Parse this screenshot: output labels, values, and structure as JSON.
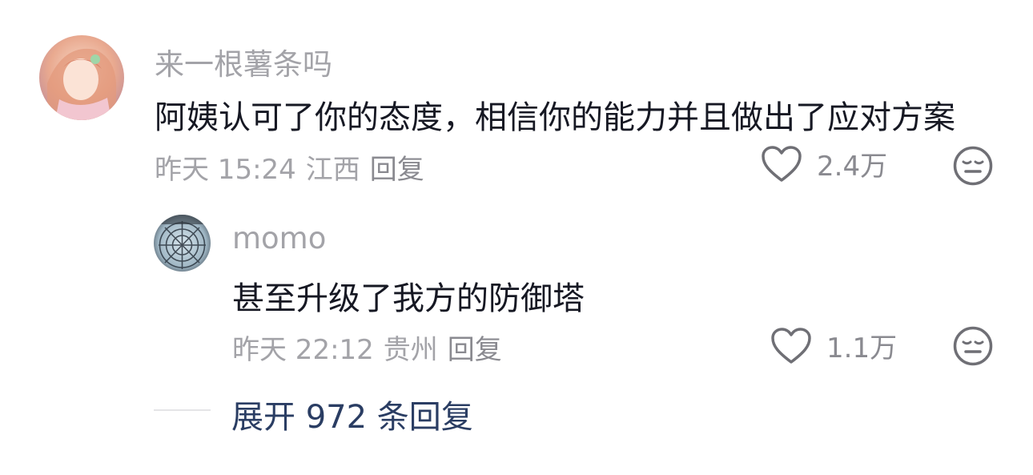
{
  "comment": {
    "username": "来一根薯条吗",
    "text": "阿姨认可了你的态度，相信你的能力并且做出了应对方案",
    "time": "昨天 15:24",
    "location": "江西",
    "reply_label": "回复",
    "likes": "2.4万"
  },
  "reply": {
    "username": "momo",
    "text": "甚至升级了我方的防御塔",
    "time": "昨天 22:12",
    "location": "贵州",
    "reply_label": "回复",
    "likes": "1.1万"
  },
  "expand": {
    "label": "展开 972 条回复"
  },
  "icons": {
    "like": "heart-outline-icon",
    "dislike": "meh-face-icon"
  },
  "colors": {
    "text": "#161823",
    "muted": "#a3a3a8",
    "expand": "#2a3d63"
  }
}
